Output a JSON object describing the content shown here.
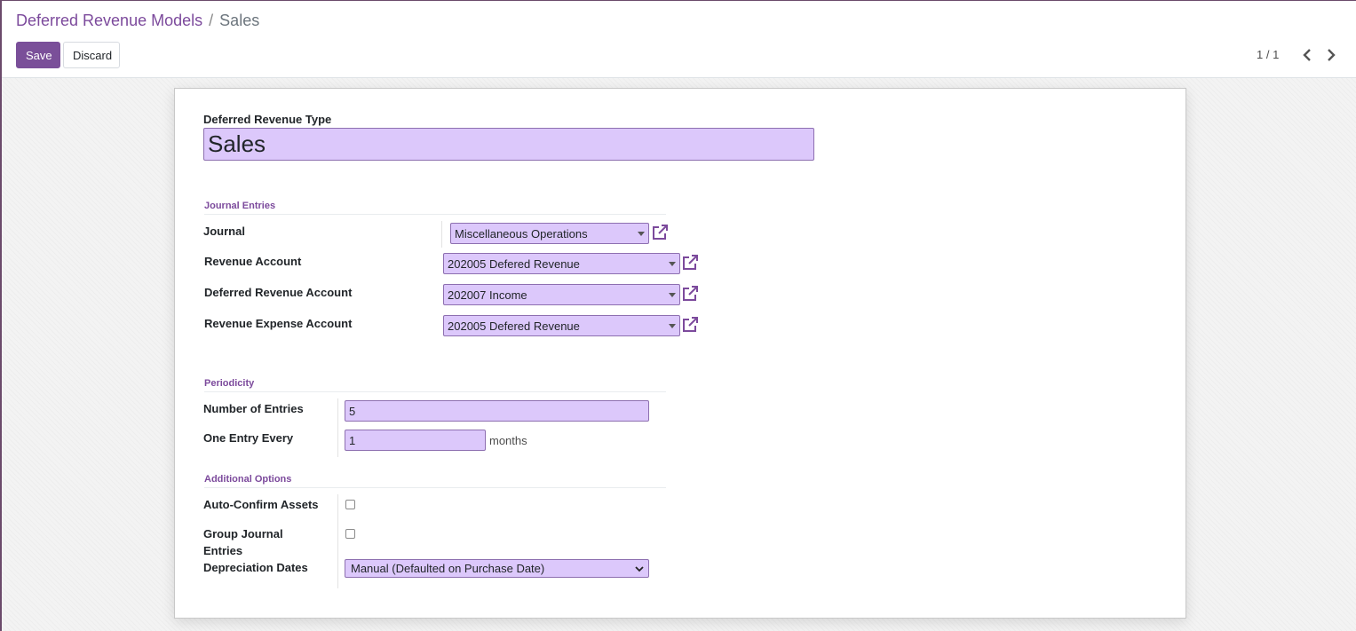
{
  "breadcrumb": {
    "parent": "Deferred Revenue Models",
    "separator": "/",
    "current": "Sales"
  },
  "toolbar": {
    "save_label": "Save",
    "discard_label": "Discard"
  },
  "pager": {
    "value": "1 / 1",
    "prev_icon": "chevron-left-icon",
    "next_icon": "chevron-right-icon"
  },
  "form": {
    "name_label": "Deferred Revenue Type",
    "name_value": "Sales",
    "journal_entries": {
      "title": "Journal Entries",
      "journal_label": "Journal",
      "journal_value": "Miscellaneous Operations",
      "revenue_account_label": "Revenue Account",
      "revenue_account_value": "202005 Defered Revenue",
      "deferred_account_label": "Deferred Revenue Account",
      "deferred_account_value": "202007 Income",
      "expense_account_label": "Revenue Expense Account",
      "expense_account_value": "202005 Defered Revenue"
    },
    "periodicity": {
      "title": "Periodicity",
      "entries_label": "Number of Entries",
      "entries_value": "5",
      "every_label": "One Entry Every",
      "every_value": "1",
      "every_unit": "months"
    },
    "additional": {
      "title": "Additional Options",
      "auto_confirm_label": "Auto-Confirm Assets",
      "auto_confirm_checked": false,
      "group_entries_label_line1": "Group Journal",
      "group_entries_label_line2": "Entries",
      "group_entries_checked": false,
      "dates_label": "Depreciation Dates",
      "dates_value": "Manual (Defaulted on Purchase Date)"
    }
  },
  "colors": {
    "brand": "#7c4a9c",
    "field_bg": "#dcc8fb",
    "save_bg": "#7a4f99"
  }
}
